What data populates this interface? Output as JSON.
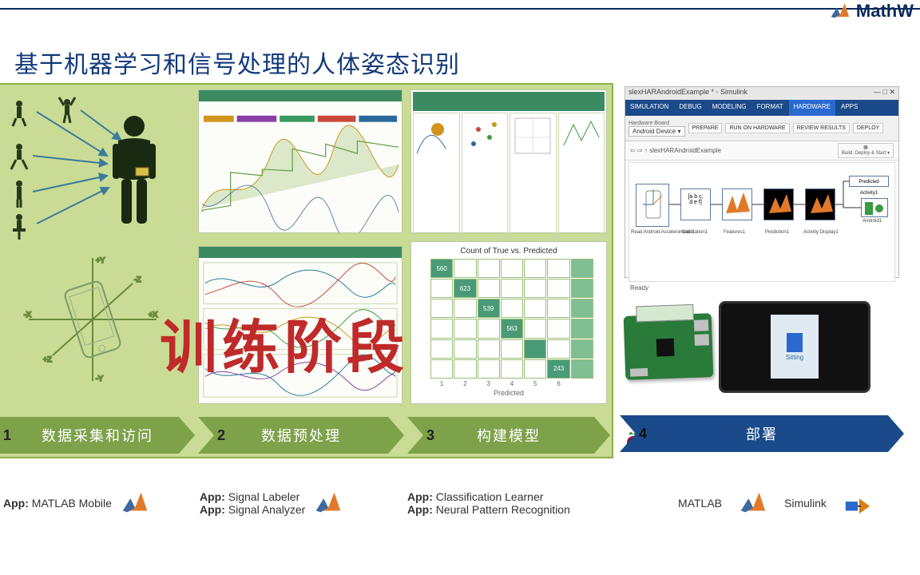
{
  "brand": "MathW",
  "title": "基于机器学习和信号处理的人体姿态识别",
  "overlay": "训练阶段",
  "steps": [
    {
      "num": "1",
      "label": "数据采集和访问",
      "color": "#7da24a"
    },
    {
      "num": "2",
      "label": "数据预处理",
      "color": "#7da24a"
    },
    {
      "num": "3",
      "label": "构建模型",
      "color": "#7da24a"
    },
    {
      "num": "4",
      "label": "部署",
      "color": "#1a4a8a"
    }
  ],
  "apps": {
    "c1": {
      "prefix": "App:",
      "line1": "MATLAB Mobile"
    },
    "c2": {
      "prefix": "App:",
      "line1": "Signal Labeler",
      "line2": "Signal Analyzer"
    },
    "c3": {
      "prefix": "App:",
      "line1": "Classification Learner",
      "line2": "Neural Pattern Recognition"
    },
    "c4": {
      "matlab": "MATLAB",
      "simulink": "Simulink"
    }
  },
  "confusion": {
    "title": "Count of True vs. Predicted",
    "xlabel": "Predicted",
    "ticks": [
      "1",
      "2",
      "3",
      "4",
      "5",
      "6"
    ],
    "diag": [
      "560",
      "623",
      "539",
      "563",
      "",
      "243"
    ]
  },
  "simulink": {
    "wtitle": "slexHARAndroidExample * - Simulink",
    "tabs": [
      "SIMULATION",
      "DEBUG",
      "MODELING",
      "FORMAT",
      "HARDWARE",
      "APPS"
    ],
    "hw_label": "Hardware Board",
    "hw_value": "Android Device",
    "buttons": [
      "PREPARE",
      "RUN ON HARDWARE",
      "REVIEW RESULTS",
      "DEPLOY"
    ],
    "bds": "Build, Deploy & Start",
    "file": "slexHARAndroidExample",
    "blocks": [
      "Read Android Accelerometer1",
      "Calibration1",
      "Features1",
      "Prediction1",
      "Activity Display1"
    ],
    "pred": "Predicted Activity1",
    "android": "Android1",
    "ready": "Ready"
  },
  "deploy": {
    "raspberry": "Raspberry Pi",
    "phone_label": "Sitting"
  }
}
